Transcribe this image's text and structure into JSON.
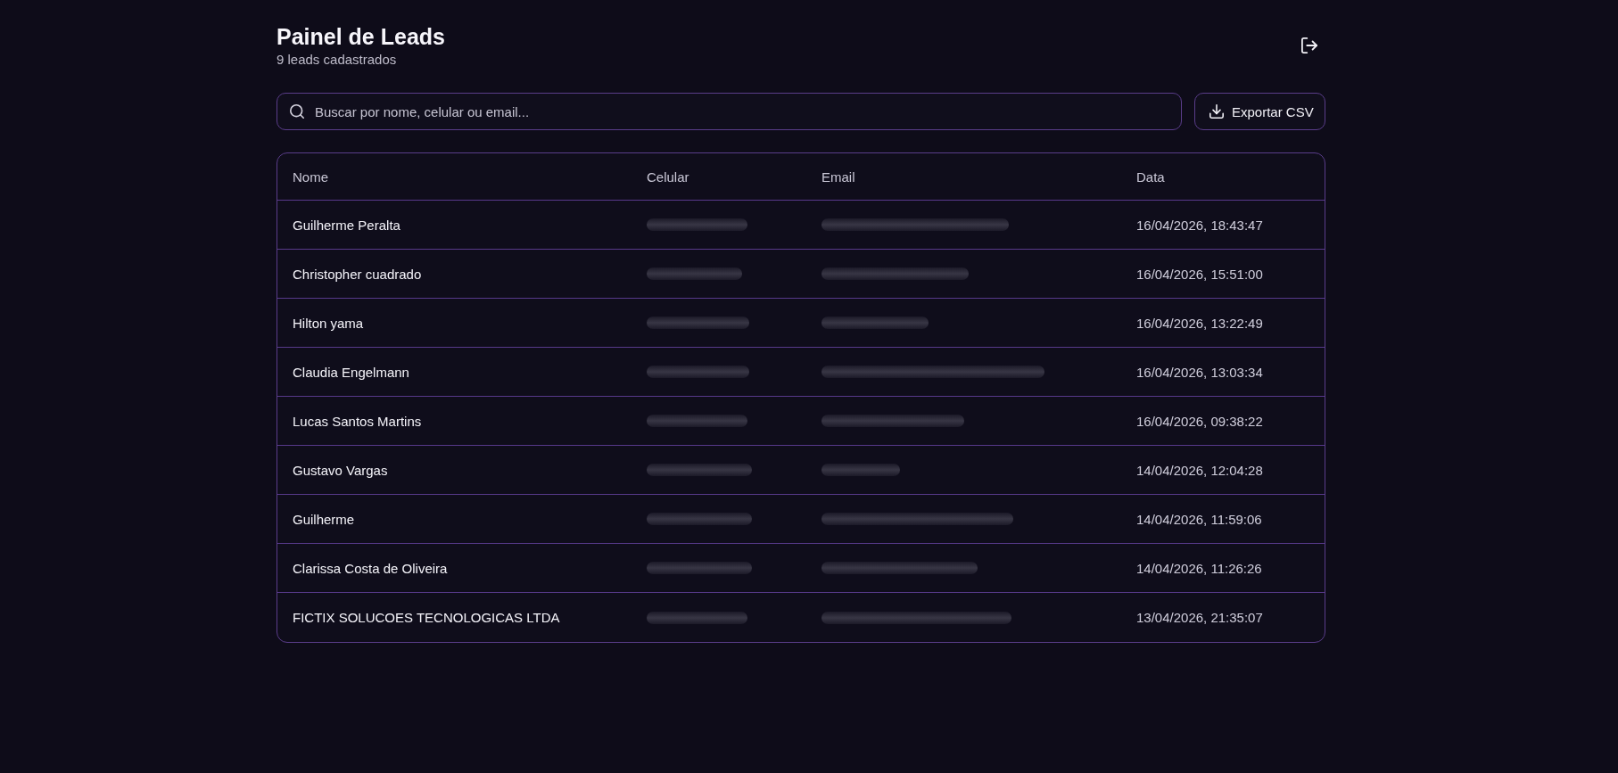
{
  "header": {
    "title": "Painel de Leads",
    "subtitle": "9 leads cadastrados"
  },
  "search": {
    "placeholder": "Buscar por nome, celular ou email..."
  },
  "export_button": {
    "label": "Exportar CSV"
  },
  "table": {
    "columns": [
      "Nome",
      "Celular",
      "Email",
      "Data"
    ],
    "rows": [
      {
        "nome": "Guilherme Peralta",
        "celular_redacted": true,
        "email_redacted": true,
        "data": "16/04/2026, 18:43:47"
      },
      {
        "nome": "Christopher cuadrado",
        "celular_redacted": true,
        "email_redacted": true,
        "data": "16/04/2026, 15:51:00"
      },
      {
        "nome": "Hilton yama",
        "celular_redacted": true,
        "email_redacted": true,
        "data": "16/04/2026, 13:22:49"
      },
      {
        "nome": "Claudia Engelmann",
        "celular_redacted": true,
        "email_redacted": true,
        "data": "16/04/2026, 13:03:34"
      },
      {
        "nome": "Lucas Santos Martins",
        "celular_redacted": true,
        "email_redacted": true,
        "data": "16/04/2026, 09:38:22"
      },
      {
        "nome": "Gustavo Vargas",
        "celular_redacted": true,
        "email_redacted": true,
        "data": "14/04/2026, 12:04:28"
      },
      {
        "nome": "Guilherme",
        "celular_redacted": true,
        "email_redacted": true,
        "data": "14/04/2026, 11:59:06"
      },
      {
        "nome": "Clarissa Costa de Oliveira",
        "celular_redacted": true,
        "email_redacted": true,
        "data": "14/04/2026, 11:26:26"
      },
      {
        "nome": "FICTIX SOLUCOES TECNOLOGICAS LTDA",
        "celular_redacted": true,
        "email_redacted": true,
        "data": "13/04/2026, 21:35:07"
      }
    ]
  }
}
